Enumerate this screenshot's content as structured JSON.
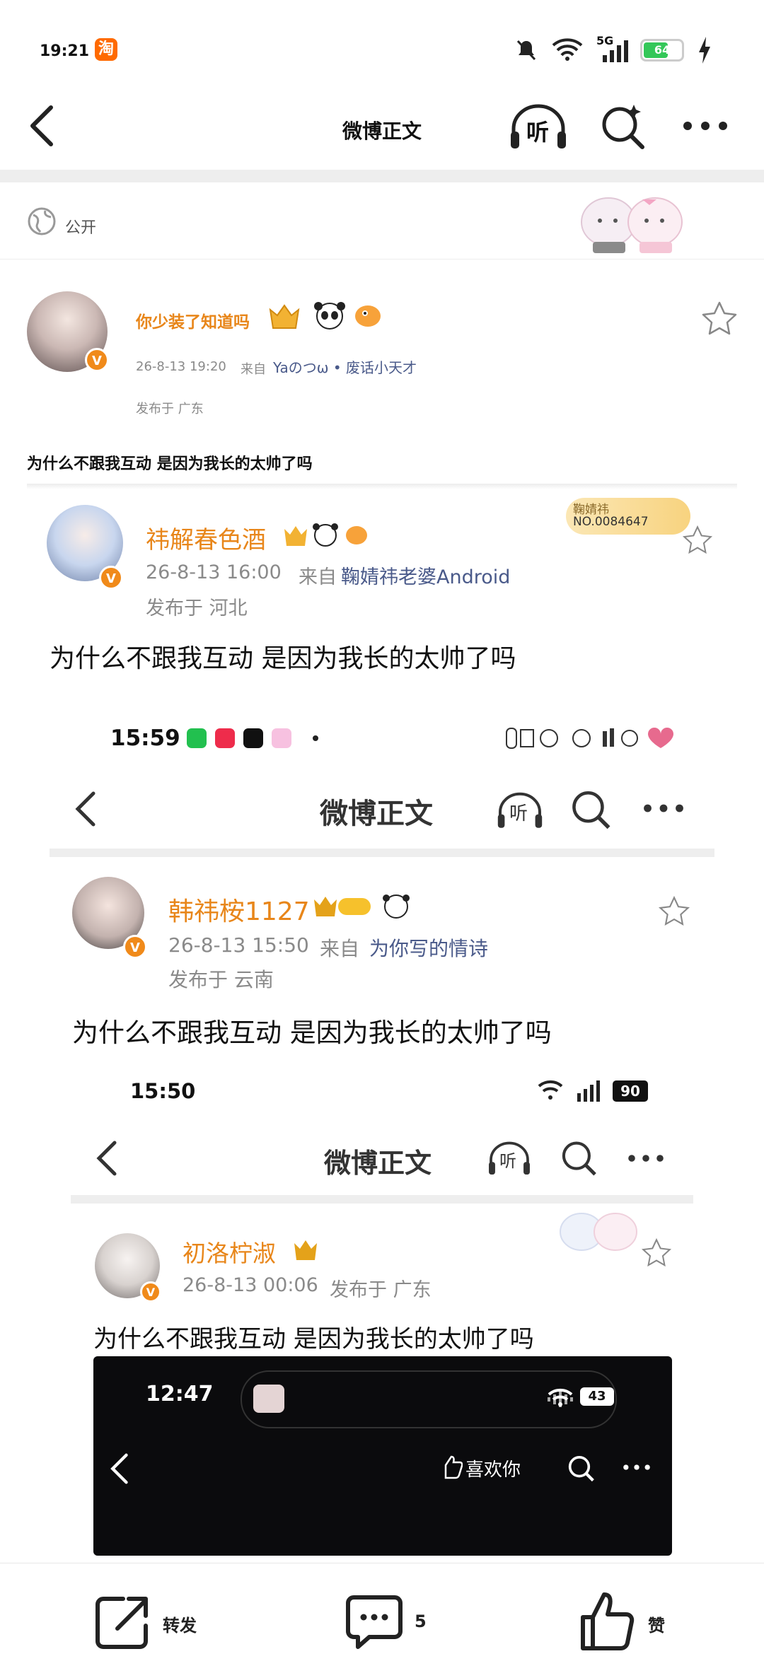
{
  "status_bar": {
    "time": "19:21",
    "app_badge": "淘",
    "battery": "64",
    "network": "5G"
  },
  "nav": {
    "title": "微博正文",
    "listen_label": "听"
  },
  "visibility": {
    "label": "公开"
  },
  "post": {
    "username": "你少装了知道吗",
    "timestamp": "26-8-13 19:20",
    "via_prefix": "来自",
    "via": "Yaのつω • 废话小天才",
    "location": "发布于 广东",
    "text": "为什么不跟我互动 是因为我长的太帅了吗"
  },
  "nested1": {
    "username": "祎解春色酒",
    "timestamp": "26-8-13 16:00",
    "via_prefix": "来自",
    "via": "鞠婧祎老婆Android",
    "location": "发布于 河北",
    "text": "为什么不跟我互动 是因为我长的太帅了吗",
    "fan_badge_name": "鞠婧祎",
    "fan_badge_no": "NO.0084647"
  },
  "nested2": {
    "status_time": "15:59",
    "nav_title": "微博正文",
    "listen_label": "听",
    "username": "韩祎桉1127",
    "timestamp": "26-8-13 15:50",
    "via_prefix": "来自",
    "via": "为你写的情诗",
    "location": "发布于 云南",
    "text": "为什么不跟我互动 是因为我长的太帅了吗"
  },
  "nested3": {
    "status_time": "15:50",
    "battery": "90",
    "nav_title": "微博正文",
    "listen_label": "听",
    "username": "初洛柠淑",
    "timestamp": "26-8-13 00:06",
    "location": "发布于 广东",
    "text": "为什么不跟我互动 是因为我长的太帅了吗"
  },
  "nested4": {
    "status_time": "12:47",
    "battery": "43",
    "like_label": "喜欢你"
  },
  "bottom_bar": {
    "repost_label": "转发",
    "comment_count": "5",
    "like_label": "赞"
  },
  "colors": {
    "username": "#e8861a",
    "vbadge": "#f08a1a",
    "via": "#4a5a8a"
  }
}
